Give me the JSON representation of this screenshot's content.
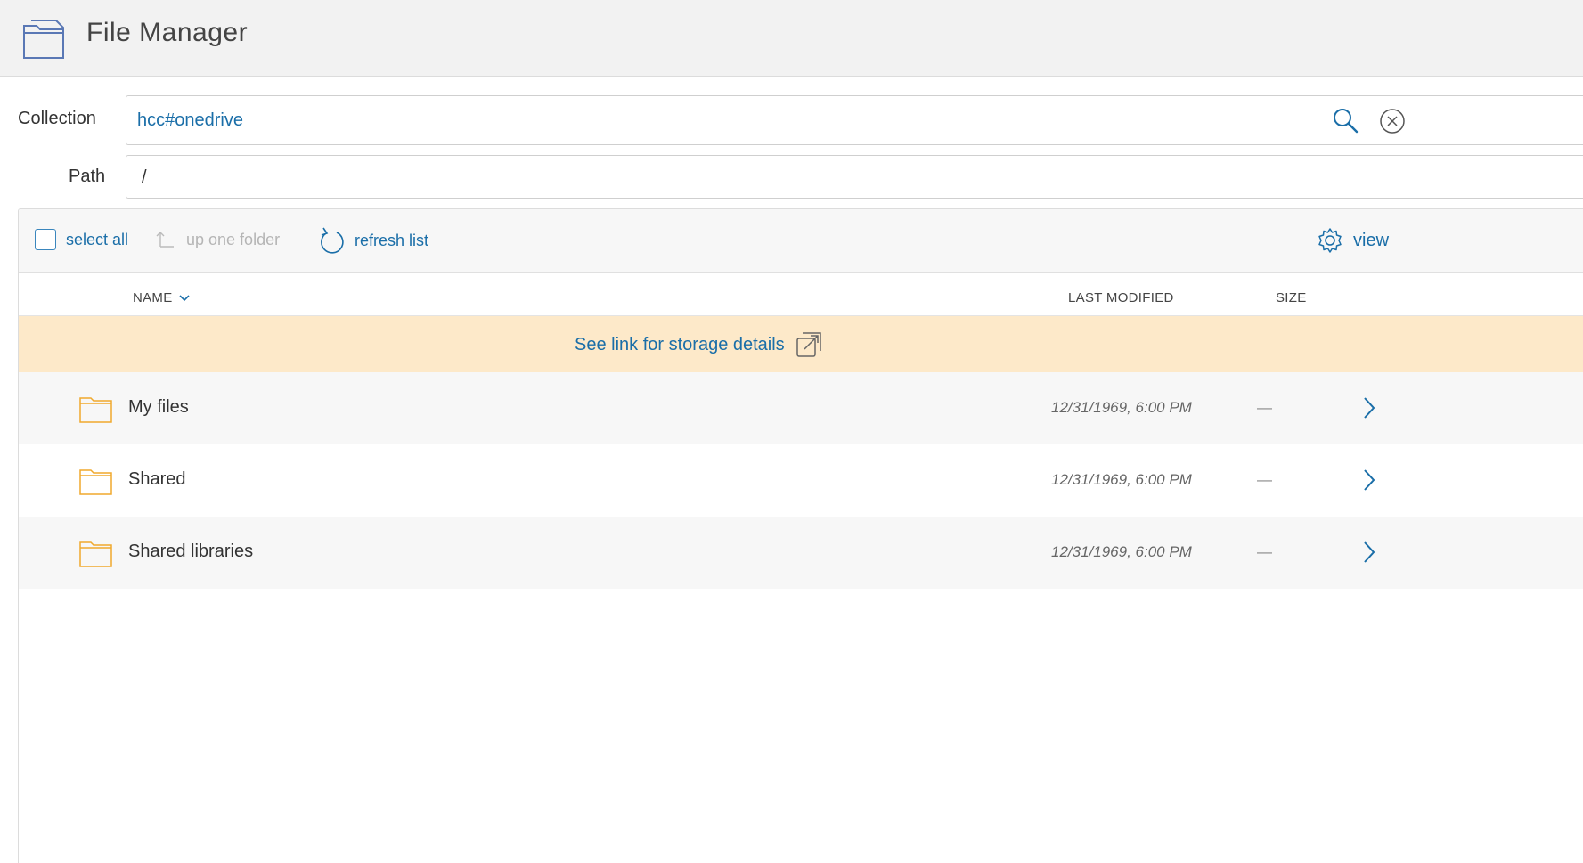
{
  "app": {
    "title": "File Manager"
  },
  "fields": {
    "collection_label": "Collection",
    "collection_value": "hcc#onedrive",
    "path_label": "Path",
    "path_value": "/"
  },
  "toolbar": {
    "select_all": "select all",
    "up_one_folder": "up one folder",
    "refresh_list": "refresh list",
    "view": "view"
  },
  "columns": {
    "name": "NAME",
    "last_modified": "LAST MODIFIED",
    "size": "SIZE"
  },
  "banner": {
    "text": "See link for storage details"
  },
  "rows": [
    {
      "name": "My files",
      "modified": "12/31/1969, 6:00 PM",
      "size": "—"
    },
    {
      "name": "Shared",
      "modified": "12/31/1969, 6:00 PM",
      "size": "—"
    },
    {
      "name": "Shared libraries",
      "modified": "12/31/1969, 6:00 PM",
      "size": "—"
    }
  ],
  "colors": {
    "accent": "#1a6ea8",
    "folder": "#f0a92d",
    "banner_bg": "#fde9c9",
    "header_bg": "#f2f2f2"
  },
  "icons": {
    "app": "folder-app-icon",
    "search": "search-icon",
    "clear": "clear-circle-x-icon",
    "up": "up-arrow-icon",
    "refresh": "refresh-icon",
    "view": "gear-icon",
    "sort": "chevron-down-icon",
    "external": "external-link-icon",
    "folder": "folder-icon",
    "navigate": "chevron-right-icon"
  }
}
